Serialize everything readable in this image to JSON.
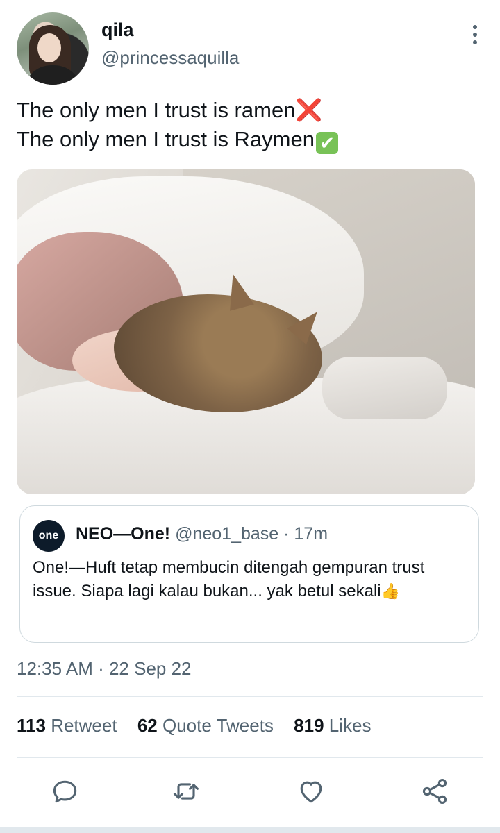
{
  "author": {
    "name": "qila",
    "handle": "@princessaquilla"
  },
  "tweet": {
    "line1": "The only men I trust is ramen",
    "line1_emoji": "❌",
    "line2": "The only men I trust is Raymen",
    "line2_emoji": "✔"
  },
  "quote_tweet": {
    "avatar_text": "one",
    "name": "NEO—One!",
    "handle": "@neo1_base",
    "separator": " · ",
    "time": "17m",
    "text": "One!—Huft tetap membucin ditengah gempuran trust issue. Siapa lagi kalau bukan... yak betul sekali",
    "emoji": "👍"
  },
  "meta": {
    "time": "12:35 AM",
    "separator": " · ",
    "date": "22 Sep 22"
  },
  "stats": {
    "retweets": "113",
    "retweets_label": "Retweet",
    "quotes": "62",
    "quotes_label": "Quote Tweets",
    "likes": "819",
    "likes_label": "Likes"
  },
  "icons": {
    "more": "more-vertical-icon",
    "reply": "reply-icon",
    "retweet": "retweet-icon",
    "like": "heart-icon",
    "share": "share-icon"
  },
  "colors": {
    "text": "#0f1419",
    "secondary": "#536471",
    "border": "#cfd9de",
    "divider": "#e1e8ed"
  }
}
